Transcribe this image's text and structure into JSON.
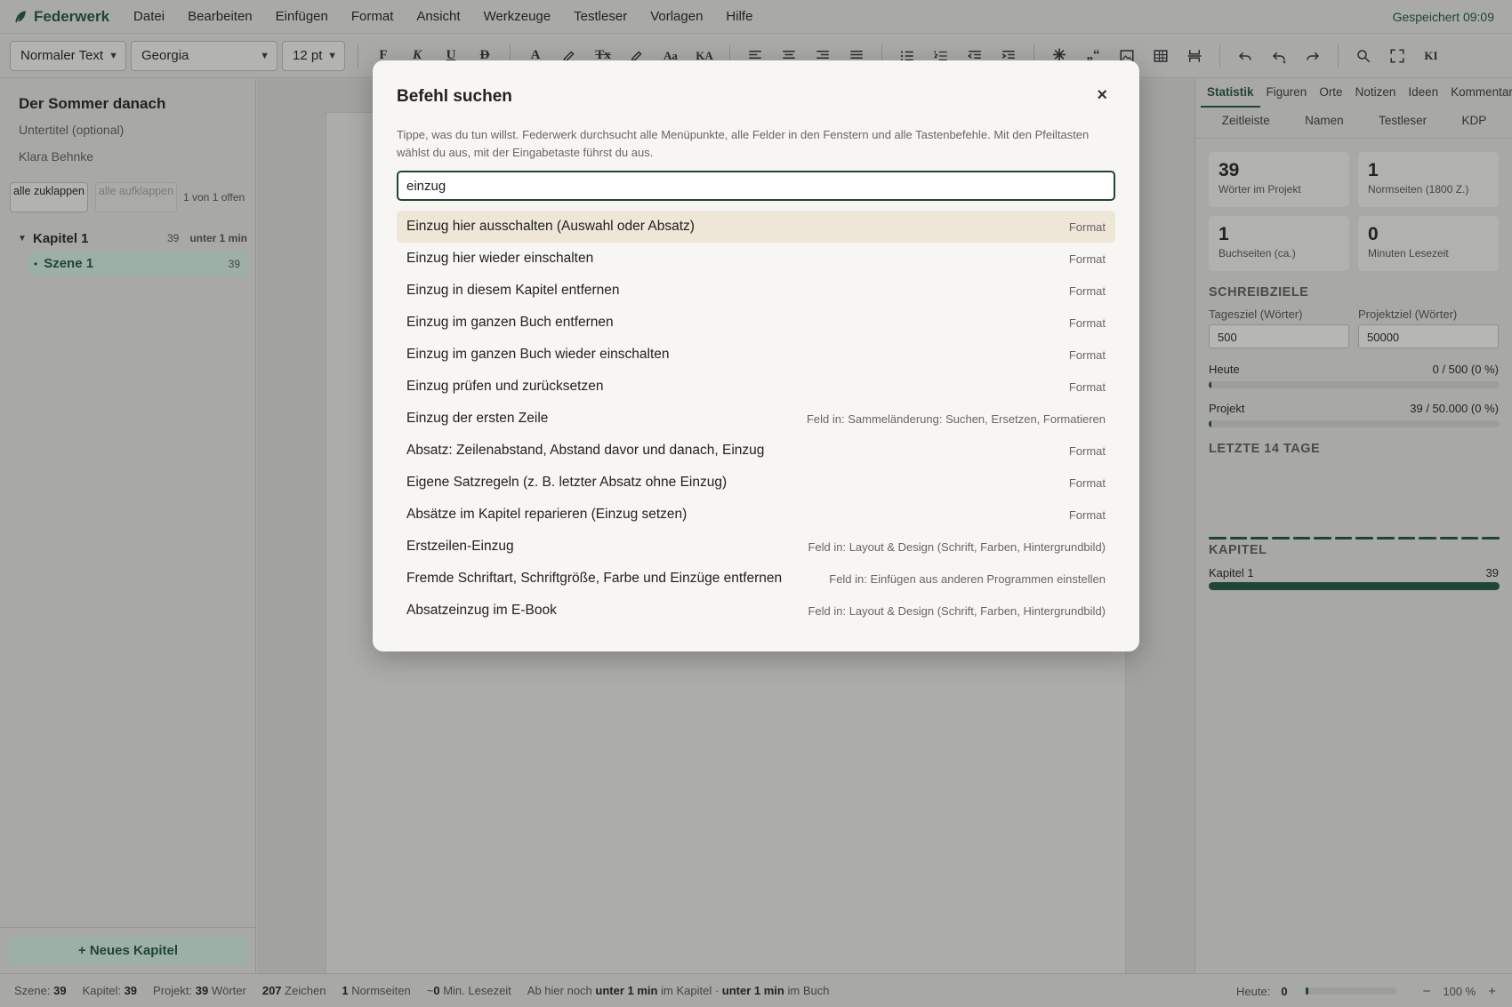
{
  "app": {
    "name": "Federwerk",
    "saved_status": "Gespeichert 09:09",
    "menu": [
      "Datei",
      "Bearbeiten",
      "Einfügen",
      "Format",
      "Ansicht",
      "Werkzeuge",
      "Testleser",
      "Vorlagen",
      "Hilfe"
    ]
  },
  "toolbar": {
    "style_select": "Normaler Text",
    "font_select": "Georgia",
    "size_select": "12 pt",
    "format_buttons": {
      "bold": "F",
      "italic": "K",
      "underline": "U",
      "strike": "D",
      "color": "A",
      "clear": "Tx",
      "case": "Aa",
      "smallcaps": "KA",
      "ai": "KI",
      "quote": "„“"
    }
  },
  "sidebar": {
    "book_title": "Der Sommer danach",
    "subtitle_placeholder": "Untertitel (optional)",
    "author": "Klara Behnke",
    "collapse_all": "alle zuklappen",
    "expand_all": "alle aufklappen",
    "open_count": "1 von 1 offen",
    "chapters": [
      {
        "name": "Kapitel 1",
        "words": "39",
        "time": "unter 1 min",
        "scenes": [
          {
            "name": "Szene 1",
            "words": "39"
          }
        ]
      }
    ],
    "new_chapter_label": "+ Neues Kapitel"
  },
  "rightpanel": {
    "tabs_row1": [
      "Statistik",
      "Figuren",
      "Orte",
      "Notizen",
      "Ideen",
      "Kommentare"
    ],
    "tabs_row2": [
      "Zeitleiste",
      "Namen",
      "Testleser",
      "KDP"
    ],
    "stats": [
      {
        "value": "39",
        "label": "Wörter im Projekt"
      },
      {
        "value": "1",
        "label": "Normseiten (1800 Z.)"
      },
      {
        "value": "1",
        "label": "Buchseiten (ca.)"
      },
      {
        "value": "0",
        "label": "Minuten Lesezeit"
      }
    ],
    "goals_heading": "SCHREIBZIELE",
    "daily_goal_label": "Tagesziel (Wörter)",
    "daily_goal_value": "500",
    "project_goal_label": "Projektziel (Wörter)",
    "project_goal_value": "50000",
    "today_label": "Heute",
    "today_value": "0 / 500 (0 %)",
    "today_progress": 0.0,
    "project_label": "Projekt",
    "project_value": "39 / 50.000 (0 %)",
    "project_progress": 0.0008,
    "last_days_heading": "LETZTE 14 TAGE",
    "chapters_heading": "KAPITEL",
    "chapter_stat": {
      "name": "Kapitel 1",
      "value": "39"
    }
  },
  "statusbar": {
    "scene_label": "Szene:",
    "scene_value": "39",
    "chapter_label": "Kapitel:",
    "chapter_value": "39",
    "project_label": "Projekt:",
    "project_value": "39",
    "project_unit": "Wörter",
    "chars_value": "207",
    "chars_unit": "Zeichen",
    "pages_value": "1",
    "pages_unit": "Normseiten",
    "read_prefix": "~",
    "read_value": "0",
    "read_unit": "Min. Lesezeit",
    "remain_prefix": "Ab hier noch",
    "remain_chapter": "unter 1 min",
    "remain_mid": "im Kapitel ·",
    "remain_book": "unter 1 min",
    "remain_suffix": "im Buch",
    "today_label": "Heute:",
    "today_value": "0",
    "zoom_minus": "−",
    "zoom_value": "100 %",
    "zoom_plus": "+"
  },
  "modal": {
    "title": "Befehl suchen",
    "close": "×",
    "description": "Tippe, was du tun willst. Federwerk durchsucht alle Menüpunkte, alle Felder in den Fenstern und alle Tastenbefehle. Mit den Pfeiltasten wählst du aus, mit der Eingabetaste führst du aus.",
    "query": "einzug",
    "results": [
      {
        "label": "Einzug hier ausschalten (Auswahl oder Absatz)",
        "category": "Format"
      },
      {
        "label": "Einzug hier wieder einschalten",
        "category": "Format"
      },
      {
        "label": "Einzug in diesem Kapitel entfernen",
        "category": "Format"
      },
      {
        "label": "Einzug im ganzen Buch entfernen",
        "category": "Format"
      },
      {
        "label": "Einzug im ganzen Buch wieder einschalten",
        "category": "Format"
      },
      {
        "label": "Einzug prüfen und zurücksetzen",
        "category": "Format"
      },
      {
        "label": "Einzug der ersten Zeile",
        "category": "Feld in: Sammeländerung: Suchen, Ersetzen, Formatieren"
      },
      {
        "label": "Absatz: Zeilenabstand, Abstand davor und danach, Einzug",
        "category": "Format"
      },
      {
        "label": "Eigene Satzregeln (z. B. letzter Absatz ohne Einzug)",
        "category": "Format"
      },
      {
        "label": "Absätze im Kapitel reparieren (Einzug setzen)",
        "category": "Format"
      },
      {
        "label": "Erstzeilen-Einzug",
        "category": "Feld in: Layout & Design (Schrift, Farben, Hintergrundbild)"
      },
      {
        "label": "Fremde Schriftart, Schriftgröße, Farbe und Einzüge entfernen",
        "category": "Feld in: Einfügen aus anderen Programmen einstellen"
      },
      {
        "label": "Absatzeinzug im E-Book",
        "category": "Feld in: Layout & Design (Schrift, Farben, Hintergrundbild)"
      }
    ]
  }
}
